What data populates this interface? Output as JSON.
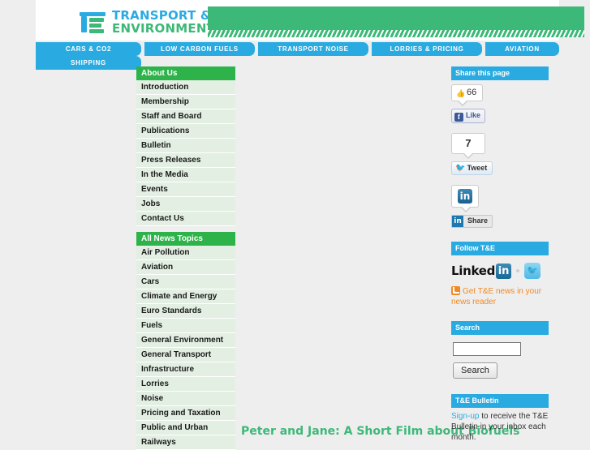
{
  "site": {
    "logo_line1": "TRANSPORT &",
    "logo_line2": "ENVIRONMENT"
  },
  "nav": {
    "tabs": [
      {
        "label": "CARS & CO2"
      },
      {
        "label": "SHIPPING"
      },
      {
        "label": "LOW CARBON FUELS"
      },
      {
        "label": "TRANSPORT NOISE"
      },
      {
        "label": "LORRIES & PRICING"
      },
      {
        "label": "AVIATION"
      }
    ]
  },
  "sidebar": {
    "about": {
      "heading": "About Us",
      "items": [
        {
          "label": "Introduction"
        },
        {
          "label": "Membership"
        },
        {
          "label": "Staff and Board"
        },
        {
          "label": "Publications"
        },
        {
          "label": "Bulletin"
        },
        {
          "label": "Press Releases"
        },
        {
          "label": "In the Media"
        },
        {
          "label": "Events"
        },
        {
          "label": "Jobs"
        },
        {
          "label": "Contact Us"
        }
      ]
    },
    "topics": {
      "heading": "All News Topics",
      "items": [
        {
          "label": "Air Pollution"
        },
        {
          "label": "Aviation"
        },
        {
          "label": "Cars"
        },
        {
          "label": "Climate and Energy"
        },
        {
          "label": "Euro Standards"
        },
        {
          "label": "Fuels"
        },
        {
          "label": "General Environment"
        },
        {
          "label": "General Transport"
        },
        {
          "label": "Infrastructure"
        },
        {
          "label": "Lorries"
        },
        {
          "label": "Noise"
        },
        {
          "label": "Pricing and Taxation"
        },
        {
          "label": "Public and Urban"
        },
        {
          "label": "Railways"
        }
      ]
    }
  },
  "main": {
    "article_title": "Peter and Jane: A Short Film about Biofuels"
  },
  "share": {
    "heading": "Share this page",
    "facebook": {
      "count": "66",
      "like_label": "Like",
      "f_glyph": "f"
    },
    "twitter": {
      "count": "7",
      "tweet_label": "Tweet"
    },
    "linkedin": {
      "glyph": "in",
      "share_label": "Share"
    }
  },
  "follow": {
    "heading": "Follow T&E",
    "linkedin_word": "Linked",
    "linkedin_glyph": "in",
    "rss_text": "Get T&E news in your news reader"
  },
  "search": {
    "heading": "Search",
    "value": "",
    "placeholder": "",
    "button_label": "Search"
  },
  "bulletin": {
    "heading": "T&E Bulletin",
    "link_label": "Sign-up",
    "text": " to receive the T&E Bulletin in your inbox each month."
  },
  "colors": {
    "brand_blue": "#29abe2",
    "brand_green": "#3cb878",
    "menu_green": "#2db34a",
    "menu_item_bg": "#e3efe3",
    "rss_orange": "#f08a24",
    "page_bg": "#eeeeee"
  }
}
